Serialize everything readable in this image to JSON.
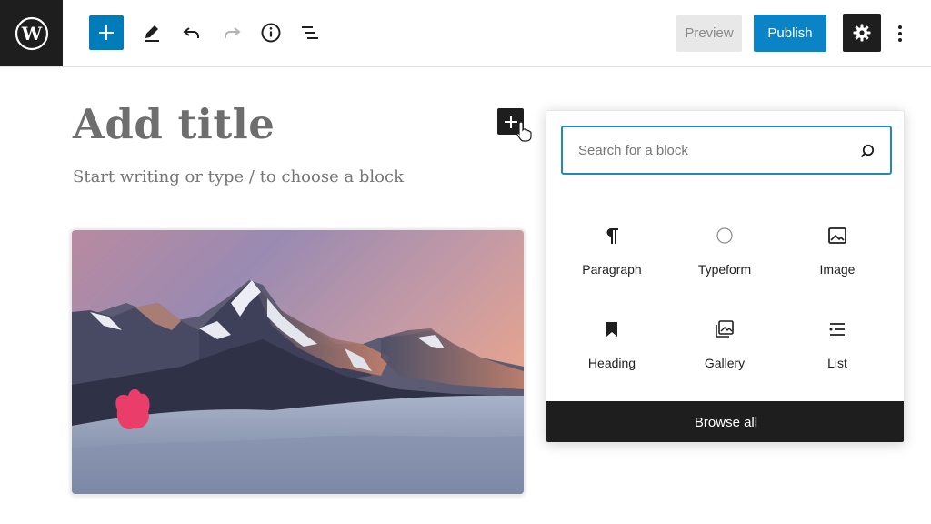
{
  "toolbar": {
    "preview_label": "Preview",
    "publish_label": "Publish",
    "icons": {
      "logo": "wordpress-logo-icon",
      "add": "plus-icon",
      "tools": "pencil-icon",
      "undo": "undo-icon",
      "redo": "redo-icon",
      "details": "info-icon",
      "outline": "list-view-icon",
      "settings": "gear-icon",
      "options": "more-vertical-icon"
    },
    "colors": {
      "add_button": "#007cba",
      "publish_button": "#0a84c6",
      "logo_background": "#1e1e1e"
    }
  },
  "editor": {
    "title_placeholder": "Add title",
    "body_placeholder": "Start writing or type / to choose a block",
    "image_block": {
      "content": "mountain-landscape-photo"
    }
  },
  "inserter": {
    "search_placeholder": "Search for a block",
    "search_value": "",
    "blocks": [
      {
        "label": "Paragraph",
        "icon": "paragraph-icon"
      },
      {
        "label": "Typeform",
        "icon": "circle-icon"
      },
      {
        "label": "Image",
        "icon": "image-icon"
      },
      {
        "label": "Heading",
        "icon": "bookmark-icon"
      },
      {
        "label": "Gallery",
        "icon": "gallery-icon"
      },
      {
        "label": "List",
        "icon": "list-icon"
      }
    ],
    "browse_all_label": "Browse all",
    "accent_color": "#1f8ab5"
  }
}
